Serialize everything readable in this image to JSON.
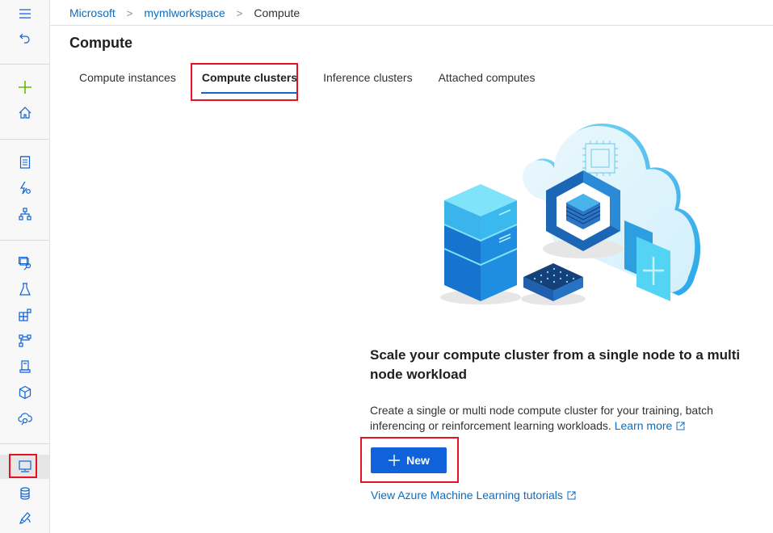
{
  "breadcrumb": {
    "items": [
      "Microsoft",
      "mymlworkspace"
    ],
    "current": "Compute",
    "separator": ">"
  },
  "page": {
    "title": "Compute"
  },
  "tabs": [
    {
      "label": "Compute instances",
      "active": false
    },
    {
      "label": "Compute clusters",
      "active": true
    },
    {
      "label": "Inference clusters",
      "active": false
    },
    {
      "label": "Attached computes",
      "active": false
    }
  ],
  "sidebar": {
    "items": [
      {
        "icon": "hamburger-menu-icon"
      },
      {
        "icon": "back-arrow-icon"
      },
      {
        "icon": "plus-icon"
      },
      {
        "icon": "home-icon"
      },
      {
        "icon": "notebook-icon"
      },
      {
        "icon": "automated-ml-icon"
      },
      {
        "icon": "designer-icon"
      },
      {
        "icon": "datasets-icon"
      },
      {
        "icon": "experiments-icon"
      },
      {
        "icon": "pipelines-icon"
      },
      {
        "icon": "models-icon"
      },
      {
        "icon": "endpoints-icon"
      },
      {
        "icon": "environments-icon"
      },
      {
        "icon": "cloud-endpoint-icon"
      },
      {
        "icon": "compute-icon",
        "active": true
      },
      {
        "icon": "datastores-icon"
      },
      {
        "icon": "data-labeling-icon"
      }
    ]
  },
  "empty_state": {
    "title": "Scale your compute cluster from a single node to a multi node workload",
    "description": "Create a single or multi node compute cluster for your training, batch inferencing or reinforcement learning workloads.",
    "learn_more": "Learn more",
    "new_button": "New",
    "tutorials_link": "View Azure Machine Learning tutorials"
  },
  "colors": {
    "accent": "#0f6cbd",
    "primary_button": "#0f62d9",
    "highlight": "#e81123",
    "add_icon": "#6bb700"
  }
}
